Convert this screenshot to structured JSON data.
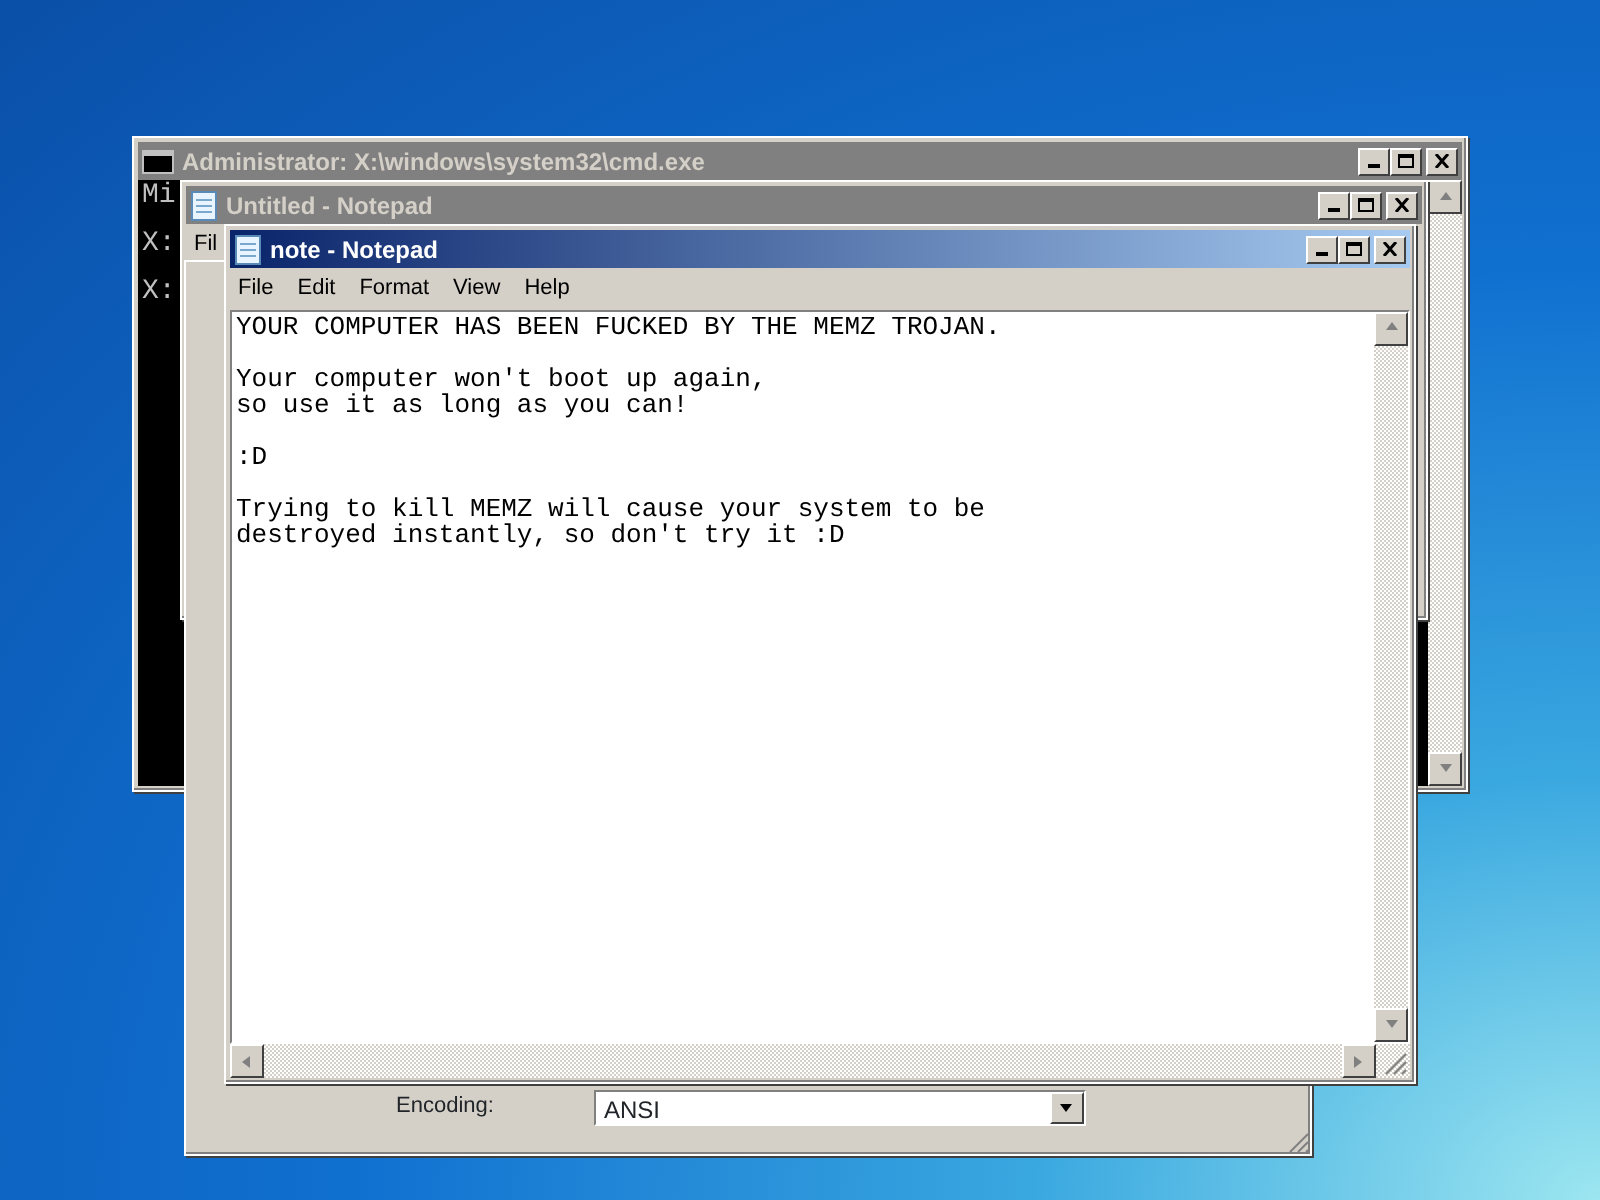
{
  "windows": [
    {
      "kind": "console",
      "title": "Administrator: X:\\windows\\system32\\cmd.exe",
      "active": false,
      "lines": [
        "Mi",
        "X:",
        "X:"
      ]
    },
    {
      "kind": "notepad",
      "title": "Untitled - Notepad",
      "active": false,
      "menu": [
        "Fil"
      ]
    },
    {
      "kind": "dialog",
      "encoding_label": "Encoding:",
      "encoding_value": "ANSI"
    },
    {
      "kind": "notepad",
      "title": "note - Notepad",
      "active": true,
      "menu": [
        "File",
        "Edit",
        "Format",
        "View",
        "Help"
      ],
      "paragraphs": [
        "YOUR COMPUTER HAS BEEN FUCKED BY THE MEMZ TROJAN.",
        "Your computer won't boot up again,\nso use it as long as you can!",
        ":D",
        "Trying to kill MEMZ will cause your system to be\ndestroyed instantly, so don't try it :D"
      ]
    }
  ]
}
